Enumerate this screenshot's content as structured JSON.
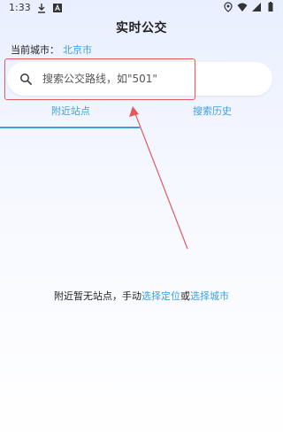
{
  "status_bar": {
    "time": "1:33",
    "icons_left": [
      "download-icon",
      "notification-a-icon"
    ],
    "icons_right": [
      "location-icon",
      "wifi-icon",
      "signal-icon",
      "battery-icon"
    ]
  },
  "header": {
    "title": "实时公交"
  },
  "city": {
    "label": "当前城市：",
    "value": "北京市"
  },
  "search": {
    "placeholder": "搜索公交路线，如\"501\"",
    "value": ""
  },
  "tabs": [
    {
      "label": "附近站点",
      "active": true
    },
    {
      "label": "搜索历史",
      "active": false
    }
  ],
  "empty_state": {
    "text_before": "附近暂无站点，手动",
    "link1": "选择定位",
    "text_middle": "或",
    "link2": "选择城市"
  },
  "colors": {
    "accent": "#3ea0e0",
    "annotation": "#e25b5b"
  }
}
